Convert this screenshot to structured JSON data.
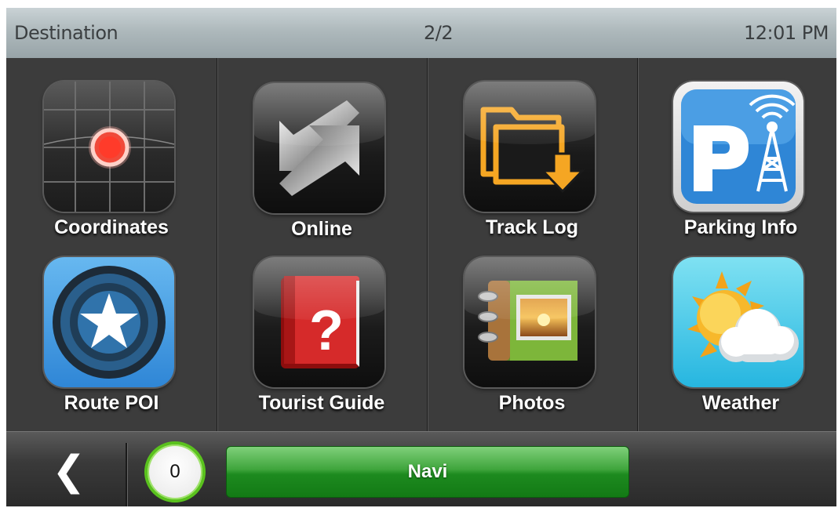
{
  "header": {
    "title": "Destination",
    "page": "2/2",
    "time": "12:01 PM"
  },
  "tiles": [
    {
      "label": "Coordinates",
      "icon": "crosshair-grid-icon"
    },
    {
      "label": "Online",
      "icon": "sync-arrows-icon"
    },
    {
      "label": "Track Log",
      "icon": "folder-download-icon"
    },
    {
      "label": "Parking Info",
      "icon": "parking-antenna-icon"
    },
    {
      "label": "Route POI",
      "icon": "star-target-icon"
    },
    {
      "label": "Tourist Guide",
      "icon": "red-book-question-icon"
    },
    {
      "label": "Photos",
      "icon": "photo-album-icon"
    },
    {
      "label": "Weather",
      "icon": "sun-cloud-icon"
    }
  ],
  "bottom": {
    "back_icon": "chevron-left-icon",
    "count": "0",
    "navi_label": "Navi"
  },
  "colors": {
    "accent_green": "#1d8a1f",
    "header_gray": "#aeb9bc",
    "background": "#3a3a3a"
  }
}
